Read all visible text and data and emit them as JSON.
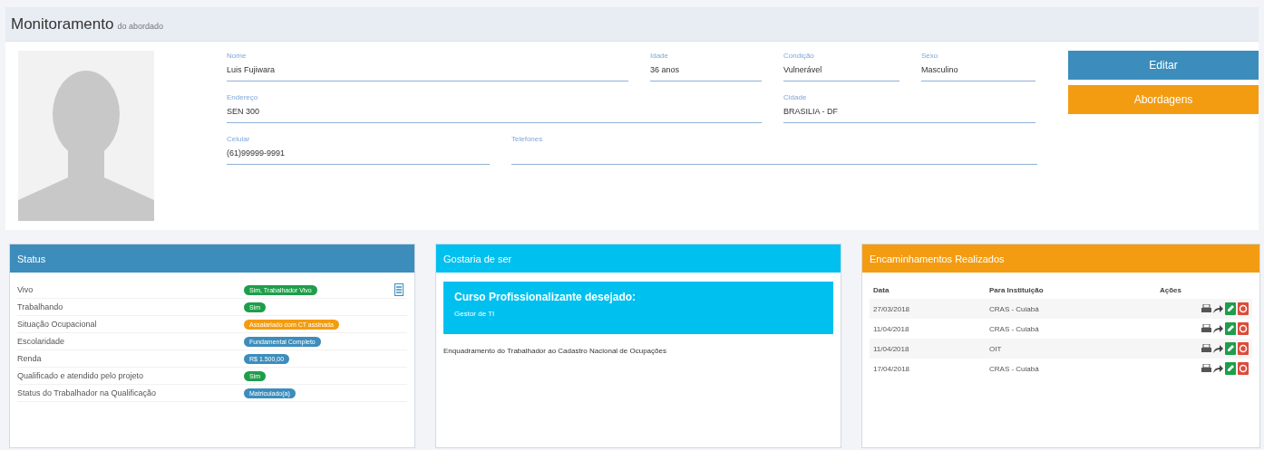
{
  "page_header": {
    "title": "Monitoramento",
    "subtitle": "do abordado"
  },
  "profile": {
    "fields": [
      {
        "label": "Nome",
        "value": "Luis Fujiwara"
      },
      {
        "label": "Idade",
        "value": "36 anos"
      },
      {
        "label": "Condição",
        "value": "Vulnerável"
      },
      {
        "label": "Sexo",
        "value": "Masculino"
      },
      {
        "label": "Endereço",
        "value": "SEN 300"
      },
      {
        "label": "Cidade",
        "value": "BRASILIA - DF"
      },
      {
        "label": "Celular",
        "value": "(61)99999-9991"
      },
      {
        "label": "Telefones"
      }
    ],
    "buttons": [
      {
        "label": "Editar",
        "kind": "primary"
      },
      {
        "label": "Abordagens",
        "kind": "warning"
      }
    ]
  },
  "status_panel": {
    "title": "Status",
    "rows": [
      {
        "label": "Vivo",
        "badge": "Sim, Trabalhador Vivo",
        "color": "#1e9e4a"
      },
      {
        "label": "Trabalhando",
        "badge": "Sim",
        "color": "#1e9e4a"
      },
      {
        "label": "Situação Ocupacional",
        "badge": "Assalariado com CT assinada",
        "color": "#f39c12"
      },
      {
        "label": "Escolaridade",
        "badge": "Fundamental Completo",
        "color": "#3c8dbc"
      },
      {
        "label": "Renda",
        "badge": "R$ 1.500,00",
        "color": "#3c8dbc"
      },
      {
        "label": "Qualificado e atendido pelo projeto",
        "badge": "Sim",
        "color": "#1e9e4a"
      },
      {
        "label": "Status do Trabalhador na Qualificação",
        "badge": "Matriculado(a)",
        "color": "#3c8dbc"
      }
    ]
  },
  "wish_panel": {
    "title": "Gostaria de ser",
    "callout_title": "Curso Profissionalizante desejado:",
    "callout_text": "Gestor de TI",
    "note": "Enquadramento do Trabalhador ao Cadastro Nacional de Ocupações"
  },
  "referrals_panel": {
    "title": "Encaminhamentos Realizados",
    "columns": [
      "Data",
      "Para Instituição",
      "Ações"
    ],
    "rows": [
      {
        "date": "27/03/2018",
        "institution": "CRAS - Cuiabá"
      },
      {
        "date": "11/04/2018",
        "institution": "CRAS - Cuiabá"
      },
      {
        "date": "11/04/2018",
        "institution": "OIT"
      },
      {
        "date": "17/04/2018",
        "institution": "CRAS - Cuiabá"
      }
    ]
  }
}
